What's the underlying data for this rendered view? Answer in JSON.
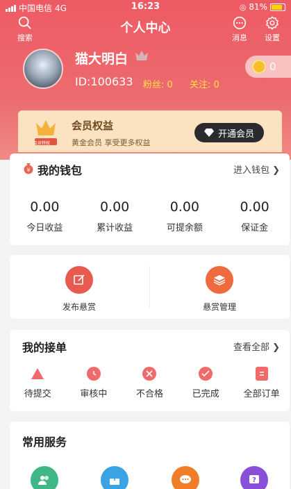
{
  "status_bar": {
    "carrier": "中国电信",
    "network": "4G",
    "time": "16:23",
    "battery": "81%"
  },
  "nav": {
    "search_label": "搜索",
    "title": "个人中心",
    "messages_label": "消息",
    "settings_label": "设置"
  },
  "profile": {
    "username": "猫大明白",
    "id_text": "ID:100633",
    "fans_text": "粉丝: 0",
    "follow_text": "关注: 0",
    "coins": "0"
  },
  "vip": {
    "crown_caption": "会员特权",
    "title": "会员权益",
    "subtitle": "黄金会员 享受更多权益",
    "button_label": "开通会员"
  },
  "wallet": {
    "title": "我的钱包",
    "link_label": "进入钱包",
    "items": [
      {
        "value": "0.00",
        "label": "今日收益"
      },
      {
        "value": "0.00",
        "label": "累计收益"
      },
      {
        "value": "0.00",
        "label": "可提余额"
      },
      {
        "value": "0.00",
        "label": "保证金"
      }
    ]
  },
  "publish": {
    "left_label": "发布悬赏",
    "right_label": "悬赏管理"
  },
  "orders": {
    "title": "我的接单",
    "link_label": "查看全部",
    "items": [
      {
        "label": "待提交",
        "icon": "warning-icon"
      },
      {
        "label": "审核中",
        "icon": "clock-icon"
      },
      {
        "label": "不合格",
        "icon": "x-icon"
      },
      {
        "label": "已完成",
        "icon": "check-icon"
      },
      {
        "label": "全部订单",
        "icon": "list-icon"
      }
    ]
  },
  "services": {
    "title": "常用服务",
    "icons": [
      "users-icon",
      "share-icon",
      "chat-icon",
      "help-icon"
    ]
  },
  "colors": {
    "header_red": "#ee5a63",
    "accent_yellow": "#ffe04a",
    "vip_gold": "#fbe3c2",
    "order_red": "#f06a6a"
  }
}
